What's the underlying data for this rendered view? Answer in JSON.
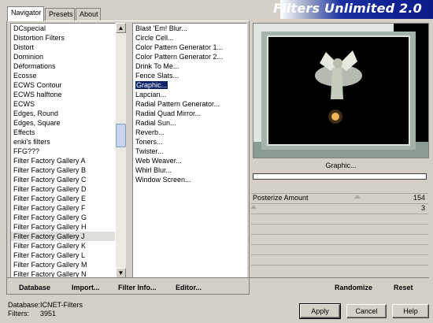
{
  "tabs": [
    {
      "label": "Navigator"
    },
    {
      "label": "Presets"
    },
    {
      "label": "About"
    }
  ],
  "banner": {
    "title": "Filters Unlimited 2.0"
  },
  "categories": [
    "DCspecial",
    "Distortion Filters",
    "Distort",
    "Dominion",
    "Déformations",
    "Ecosse",
    "ECWS Contour",
    "ECWS halftone",
    "ECWS",
    "Edges, Round",
    "Edges, Square",
    "Effects",
    "enki's filters",
    "FFG???",
    "Filter Factory Gallery A",
    "Filter Factory Gallery B",
    "Filter Factory Gallery C",
    "Filter Factory Gallery D",
    "Filter Factory Gallery E",
    "Filter Factory Gallery F",
    "Filter Factory Gallery G",
    "Filter Factory Gallery H",
    "Filter Factory Gallery J",
    "Filter Factory Gallery K",
    "Filter Factory Gallery L",
    "Filter Factory Gallery M",
    "Filter Factory Gallery N"
  ],
  "filters": [
    "Blast 'Em! Blur...",
    "Circle Cell...",
    "Color Pattern Generator 1...",
    "Color Pattern Generator 2...",
    "Drink To Me...",
    "Fence Slats...",
    "Graphic...",
    "Lapcian...",
    "Radial Pattern Generator...",
    "Radial Quad Mirror...",
    "Radial Sun...",
    "Reverb...",
    "Toners...",
    "Twister...",
    "Web Weaver...",
    "Whirl Blur...",
    "Window Screen..."
  ],
  "selected_category": "Filter Factory Gallery J",
  "selected_filter": "Graphic...",
  "preview": {
    "filter_name": "Graphic..."
  },
  "sliders": [
    {
      "label": "Posterize Amount",
      "value": "154",
      "fraction": 0.6
    },
    {
      "label": "",
      "value": "3",
      "fraction": 0.0118
    }
  ],
  "bottom_bar": {
    "database": "Database",
    "import": "Import...",
    "filter_info": "Filter Info...",
    "editor": "Editor...",
    "randomize": "Randomize",
    "reset": "Reset"
  },
  "status": {
    "database_label": "Database:",
    "database_value": "ICNET-Filters",
    "filters_label": "Filters:",
    "filters_value": "3951"
  },
  "buttons": {
    "apply": "Apply",
    "cancel": "Cancel",
    "help": "Help"
  },
  "colors": {
    "banner": "#0a1a88",
    "selection": "#0a246a"
  }
}
